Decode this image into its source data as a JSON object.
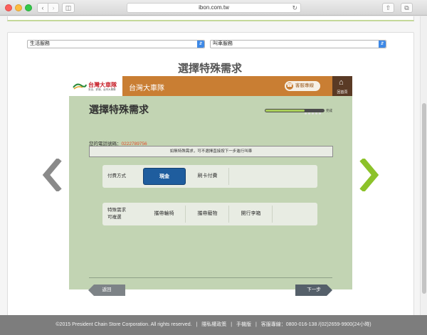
{
  "browser": {
    "url": "ibon.com.tw"
  },
  "filters": {
    "category_select": "生活服務",
    "service_select": "叫車服務"
  },
  "page": {
    "title": "選擇特殊需求"
  },
  "kiosk": {
    "logo_main": "台灣大車隊",
    "logo_sub": "安全、舒適、台灣大車隊",
    "brand": "台灣大車隊",
    "service_line": "客服專線",
    "home_label": "回首頁",
    "title": "選擇特殊需求",
    "progress": {
      "fraction": 0.67,
      "label": "完成"
    },
    "phone_label": "您的電話號碼：",
    "phone_number": "0222789756",
    "notice": "如無特殊需求，可不選擇直接按下一步進行叫車",
    "payment": {
      "label": "付費方式",
      "options": [
        "現金",
        "刷卡付費"
      ],
      "selected": "現金"
    },
    "special": {
      "label_line1": "特殊需求",
      "label_line2": "可複選",
      "options": [
        "攜帶輪椅",
        "攜帶寵物",
        "開行李箱"
      ]
    },
    "back_label": "返回",
    "next_label": "下一步"
  },
  "footer": {
    "copyright": "©2015 President Chain Store Corporation. All rights reserved.",
    "privacy": "隱私權政策",
    "mobile": "手機版",
    "hotline": "客服專線：0800-016-138 /(02)2659-9900(24小時)",
    "separator": "|"
  },
  "colors": {
    "kiosk_bg": "#c2d4b3",
    "kiosk_header": "#c97e33",
    "selected_btn": "#1f5d9e",
    "next_arrow": "#8cc22a",
    "prev_arrow": "#8a8a8a"
  }
}
